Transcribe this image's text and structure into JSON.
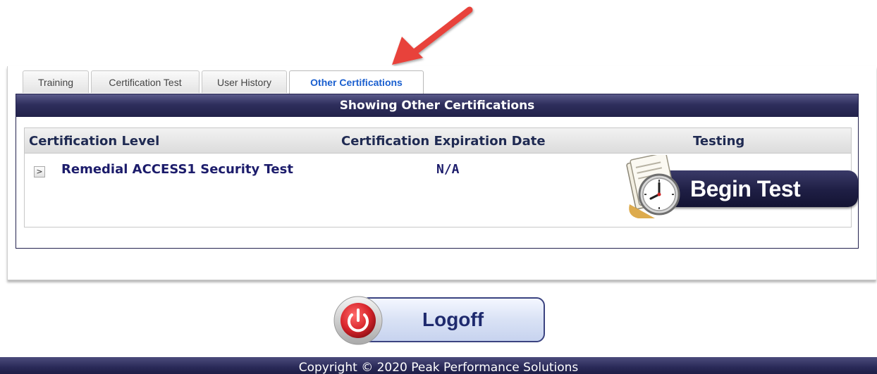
{
  "tabs": [
    {
      "label": "Training"
    },
    {
      "label": "Certification Test"
    },
    {
      "label": "User History"
    },
    {
      "label": "Other Certifications"
    }
  ],
  "section_title": "Showing Other Certifications",
  "table": {
    "headers": [
      "Certification Level",
      "Certification Expiration Date",
      "Testing"
    ],
    "rows": [
      {
        "expander": ">",
        "level": "Remedial ACCESS1 Security Test",
        "expiration": "N/A",
        "action": "Begin Test"
      }
    ]
  },
  "logoff_label": "Logoff",
  "footer_text": "Copyright © 2020 Peak Performance Solutions",
  "colors": {
    "header_navy": "#2e2e5c",
    "active_tab_text": "#1a5fcf",
    "annotation_arrow": "#e8433a",
    "power_button_red": "#d8262c"
  },
  "icons": [
    "annotation-arrow-icon",
    "clock-document-icon",
    "power-icon",
    "expand-chevron-icon"
  ]
}
